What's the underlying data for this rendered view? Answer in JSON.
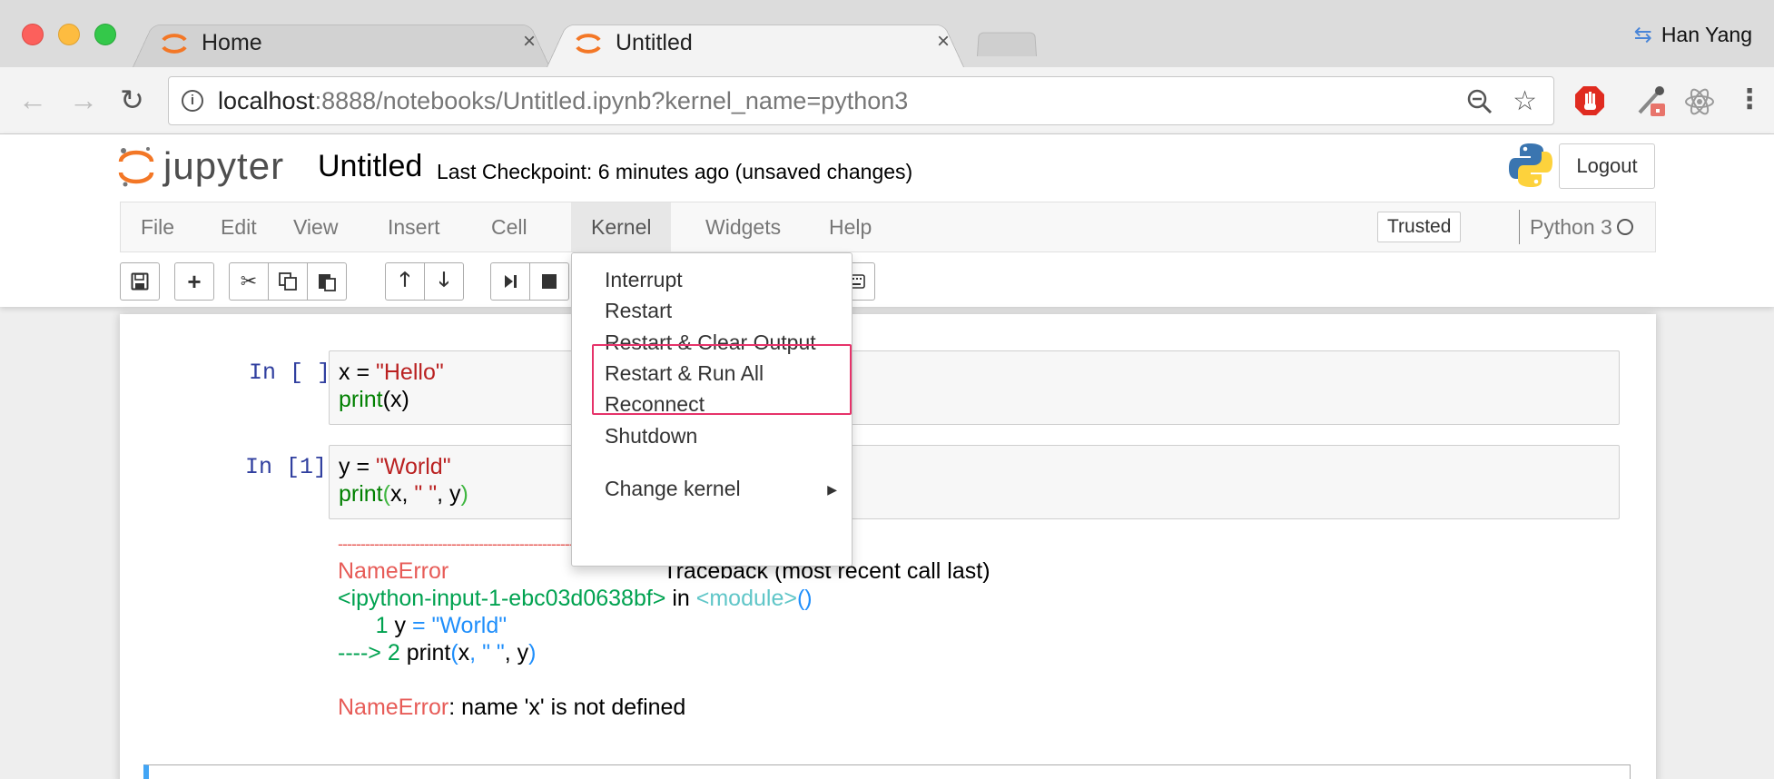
{
  "browser": {
    "tabs": [
      {
        "label": "Home",
        "active": false
      },
      {
        "label": "Untitled",
        "active": true
      }
    ],
    "tab_close": "×",
    "profile_name": "Han Yang",
    "address": {
      "host": "localhost",
      "rest": ":8888/notebooks/Untitled.ipynb?kernel_name=python3"
    }
  },
  "jupyter": {
    "logo_text": "jupyter",
    "notebook_name": "Untitled",
    "checkpoint": "Last Checkpoint: 6 minutes ago (unsaved changes)",
    "logout_label": "Logout",
    "menu": [
      "File",
      "Edit",
      "View",
      "Insert",
      "Cell",
      "Kernel",
      "Widgets",
      "Help"
    ],
    "open_menu": "Kernel",
    "trusted_label": "Trusted",
    "kernel_name": "Python 3"
  },
  "kernel_menu": {
    "items": [
      "Interrupt",
      "Restart",
      "Restart & Clear Output",
      "Restart & Run All",
      "Reconnect",
      "Shutdown",
      "Change kernel"
    ],
    "highlighted": [
      "Restart & Clear Output",
      "Restart & Run All"
    ]
  },
  "cells": [
    {
      "prompt": "In [ ]:",
      "line1": {
        "var": "x = ",
        "str": "\"Hello\""
      },
      "line2": {
        "fn": "print",
        "open": "(",
        "args": "x",
        "close": ")"
      }
    },
    {
      "prompt": "In [1]:",
      "line1": {
        "var": "y = ",
        "str": "\"World\""
      },
      "line2": {
        "fn": "print",
        "open": "(",
        "a1": "x, ",
        "a2": "\" \"",
        "a3": ", y",
        "close": ")"
      }
    }
  ],
  "traceback": {
    "dashes": "---------------------------------------------------------------------------",
    "err_name": "NameError",
    "header_rest": "Traceback (most recent call last)",
    "input_ref": "<ipython-input-1-ebc03d0638bf>",
    "in_word": " in ",
    "module_ref": "<module>",
    "module_parens": "()",
    "line1_num": "      1 ",
    "line1_code_a": "y ",
    "line1_code_eq": "=",
    "line1_code_str": " \"World\"",
    "arrow": "----> 2 ",
    "line2_fn": "print",
    "line2_open": "(",
    "line2_a": "x",
    "line2_comma": ",",
    "line2_str": " \" \"",
    "line2_b": ", y",
    "line2_close": ")",
    "final_name": "NameError",
    "final_msg": ": name 'x' is not defined"
  },
  "colors": {
    "accent_orange": "#f37726",
    "prompt_blue": "#303f9f",
    "string_red": "#ba2121",
    "builtin_green": "#008000",
    "highlight_pink": "#e6336a",
    "cell_selected_blue": "#42a5f5"
  }
}
